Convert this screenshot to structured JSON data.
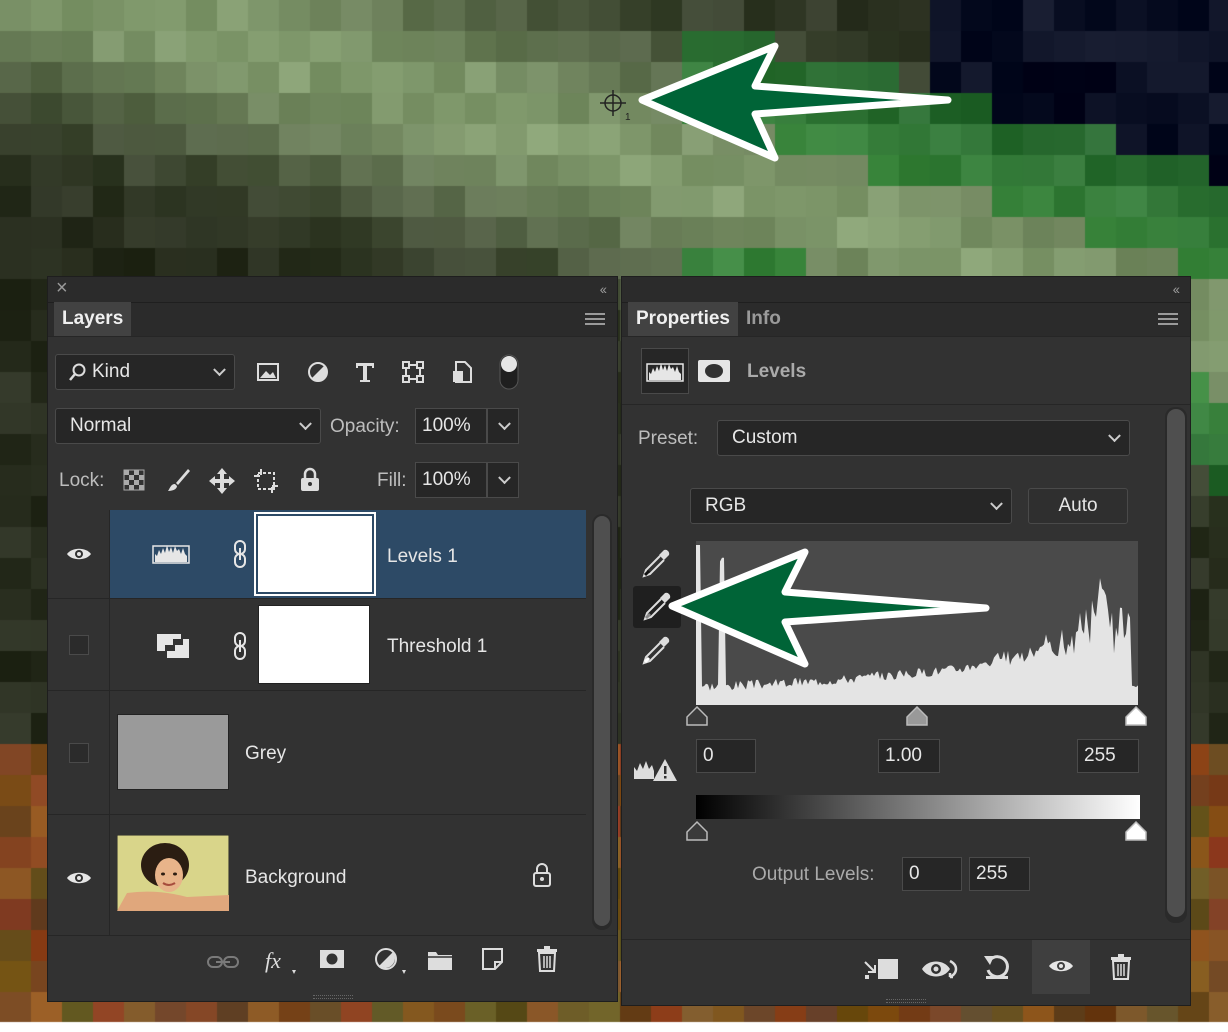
{
  "layers_panel": {
    "tab_label": "Layers",
    "filter_kind": "Kind",
    "blend_mode": "Normal",
    "opacity_label": "Opacity:",
    "opacity_value": "100%",
    "lock_label": "Lock:",
    "fill_label": "Fill:",
    "fill_value": "100%",
    "layers": [
      {
        "name": "Levels 1",
        "visible": true,
        "selected": true
      },
      {
        "name": "Threshold 1",
        "visible": false,
        "selected": false
      },
      {
        "name": "Grey",
        "visible": false,
        "selected": false,
        "thumb_color": "#9a9a9a"
      },
      {
        "name": "Background",
        "visible": true,
        "selected": false,
        "locked": true
      }
    ]
  },
  "properties_panel": {
    "tab_properties": "Properties",
    "tab_info": "Info",
    "adjustment_name": "Levels",
    "preset_label": "Preset:",
    "preset_value": "Custom",
    "channel_value": "RGB",
    "auto_button": "Auto",
    "input_black": "0",
    "input_gamma": "1.00",
    "input_white": "255",
    "output_label": "Output Levels:",
    "output_black": "0",
    "output_white": "255"
  },
  "colors": {
    "panel_bg": "#323232",
    "selection": "#2d4a66",
    "arrow_fill": "#006437",
    "histogram_bg": "#4a4a4a",
    "histogram_fill": "#e4e4e4"
  }
}
